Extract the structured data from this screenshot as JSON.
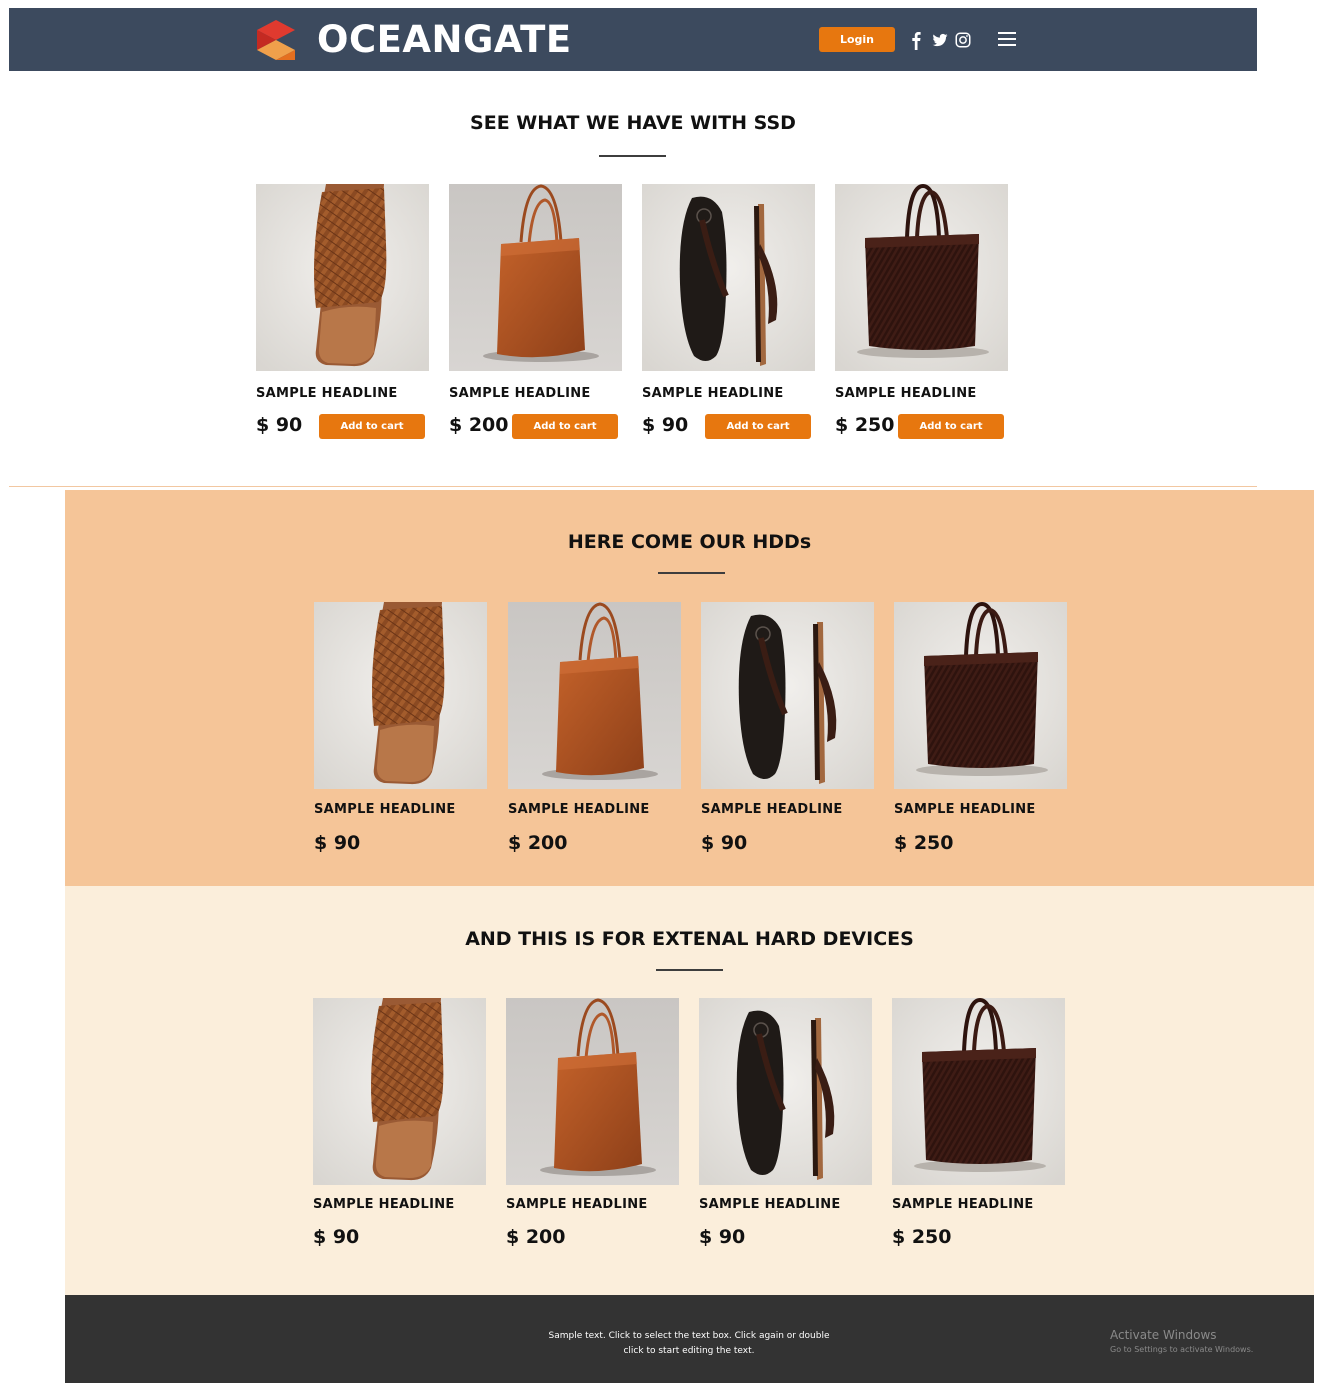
{
  "header": {
    "brand": "OCEANGATE",
    "login_label": "Login",
    "icons": [
      "facebook-icon",
      "twitter-icon",
      "instagram-icon",
      "hamburger-menu-icon"
    ]
  },
  "colors": {
    "header_bg": "#3c4a5e",
    "accent": "#e7770f",
    "hdd_section_bg": "#f5c598",
    "external_section_bg": "#fbeedb",
    "footer_bg": "#333333"
  },
  "sections": [
    {
      "title": "SEE WHAT WE HAVE WITH SSD",
      "products": [
        {
          "headline": "SAMPLE HEADLINE",
          "price": "$ 90",
          "cart_label": "Add to cart",
          "image": "woven-leather-sandal"
        },
        {
          "headline": "SAMPLE HEADLINE",
          "price": "$ 200",
          "cart_label": "Add to cart",
          "image": "tan-leather-tote"
        },
        {
          "headline": "SAMPLE HEADLINE",
          "price": "$ 90",
          "cart_label": "Add to cart",
          "image": "black-flip-flops"
        },
        {
          "headline": "SAMPLE HEADLINE",
          "price": "$ 250",
          "cart_label": "Add to cart",
          "image": "dark-woven-tote"
        }
      ]
    },
    {
      "title": "HERE COME OUR HDDs",
      "products": [
        {
          "headline": "SAMPLE HEADLINE",
          "price": "$ 90",
          "image": "woven-leather-sandal"
        },
        {
          "headline": "SAMPLE HEADLINE",
          "price": "$ 200",
          "image": "tan-leather-tote"
        },
        {
          "headline": "SAMPLE HEADLINE",
          "price": "$ 90",
          "image": "black-flip-flops"
        },
        {
          "headline": "SAMPLE HEADLINE",
          "price": "$ 250",
          "image": "dark-woven-tote"
        }
      ]
    },
    {
      "title": "AND THIS IS FOR EXTENAL HARD DEVICES",
      "products": [
        {
          "headline": "SAMPLE HEADLINE",
          "price": "$ 90",
          "image": "woven-leather-sandal"
        },
        {
          "headline": "SAMPLE HEADLINE",
          "price": "$ 200",
          "image": "tan-leather-tote"
        },
        {
          "headline": "SAMPLE HEADLINE",
          "price": "$ 90",
          "image": "black-flip-flops"
        },
        {
          "headline": "SAMPLE HEADLINE",
          "price": "$ 250",
          "image": "dark-woven-tote"
        }
      ]
    }
  ],
  "footer": {
    "text_line1": "Sample text. Click to select the text box. Click again or double",
    "text_line2": "click to start editing the text.",
    "activate_title": "Activate Windows",
    "activate_sub": "Go to Settings to activate Windows."
  }
}
